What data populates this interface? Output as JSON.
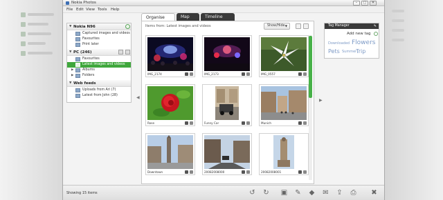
{
  "window": {
    "title": "Nokia Photos",
    "minimize": "–",
    "maximize": "□",
    "close": "✕"
  },
  "menu": [
    "File",
    "Edit",
    "View",
    "Tools",
    "Help"
  ],
  "sidebar": {
    "sections": [
      {
        "label": "Nokia N96",
        "items": [
          {
            "label": "Captured images and videos"
          },
          {
            "label": "Favourites"
          },
          {
            "label": "Print later"
          }
        ]
      },
      {
        "label": "PC (246)",
        "items": [
          {
            "label": "Favourites"
          },
          {
            "label": "Latest images and videos (15)",
            "selected": true
          },
          {
            "label": "Albums"
          },
          {
            "label": "Folders"
          }
        ]
      },
      {
        "label": "Web feeds",
        "items": [
          {
            "label": "Uploads from Ari (7)"
          },
          {
            "label": "Latest from John (28)"
          }
        ]
      }
    ]
  },
  "tabs": [
    {
      "label": "Organise",
      "active": true
    },
    {
      "label": "Map",
      "active": false
    },
    {
      "label": "Timeline",
      "active": false
    }
  ],
  "content": {
    "breadcrumb": "Items from: Latest images and videos",
    "showhide_label": "Show/Hide",
    "thumbnails": [
      {
        "caption": "IMG_2174",
        "scene": "concert"
      },
      {
        "caption": "IMG_2173",
        "scene": "concert2"
      },
      {
        "caption": "IMG_0557",
        "scene": "lily"
      },
      {
        "caption": "Rose",
        "scene": "rose"
      },
      {
        "caption": "Funny Car",
        "scene": "car"
      },
      {
        "caption": "Munich",
        "scene": "munich"
      },
      {
        "caption": "Downtown",
        "scene": "downtown"
      },
      {
        "caption": "20082008000",
        "scene": "street"
      },
      {
        "caption": "20082008001",
        "scene": "monument"
      }
    ]
  },
  "tag_manager": {
    "title": "Tag Manager",
    "new_tag_label": "Add new tag",
    "tags": [
      "Downloaded",
      "Flowers",
      "Pets",
      "Summer",
      "Trip"
    ]
  },
  "status": {
    "count_text": "Showing 15 items"
  },
  "colors": {
    "accent_green": "#3fa73c",
    "tab_dark": "#3a3a3a",
    "tag_blue": "#7d9ac6"
  }
}
